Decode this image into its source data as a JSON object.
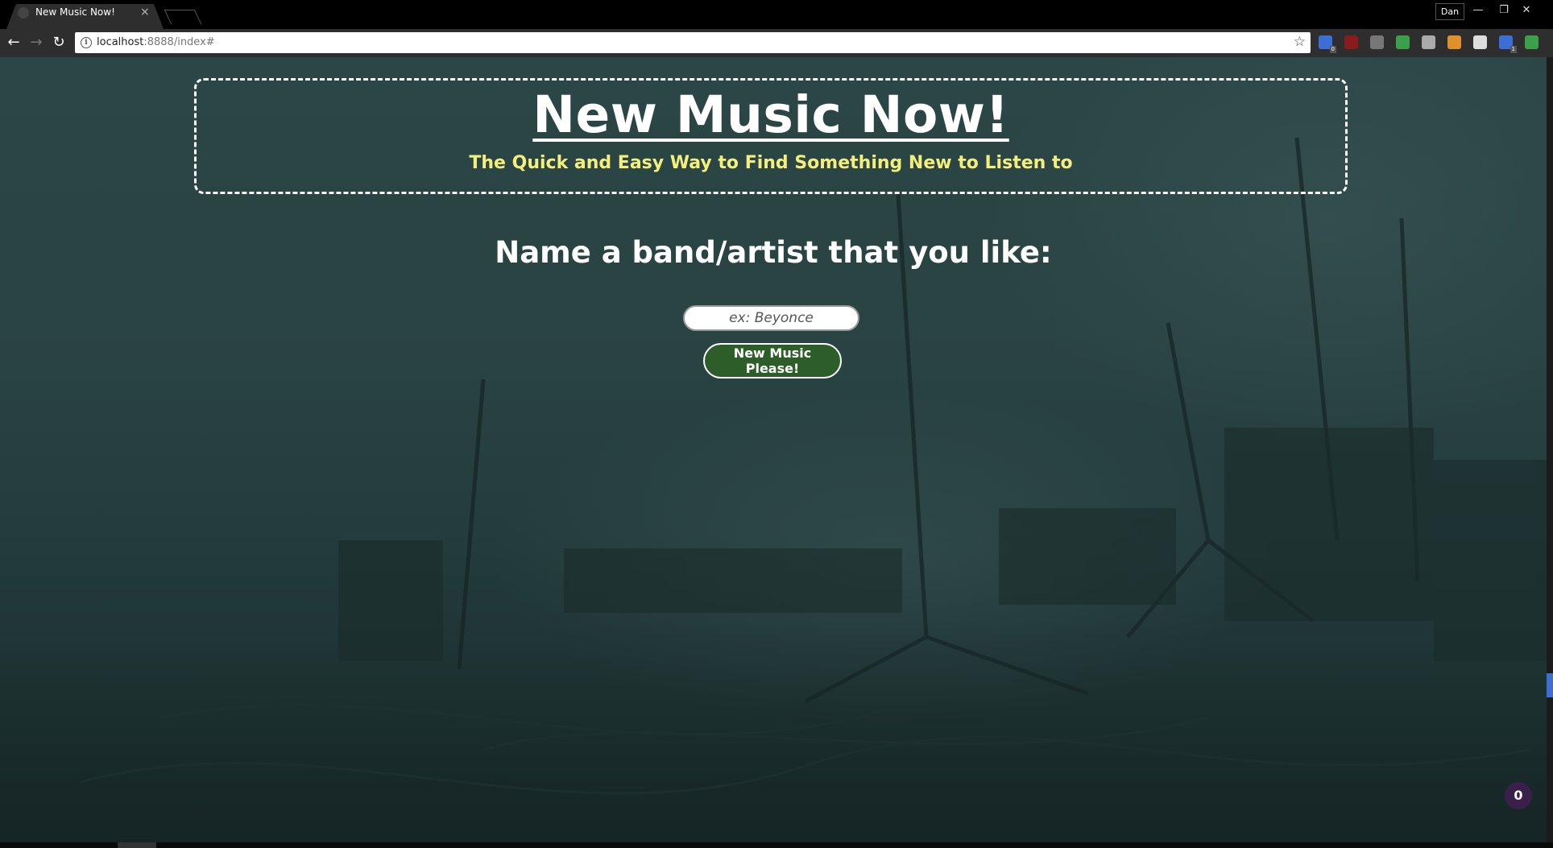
{
  "browser": {
    "tab_title": "New Music Now!",
    "tab_close": "×",
    "profile_name": "Dan",
    "url_host": "localhost",
    "url_rest": ":8888/index#",
    "controls": {
      "minimize": "—",
      "restore": "❐",
      "close": "✕"
    },
    "nav": {
      "back": "←",
      "forward": "→",
      "reload": "↻"
    },
    "extensions": [
      {
        "name": "extension-1-icon",
        "color": "#3b6fd6",
        "badge": "0"
      },
      {
        "name": "ublock-icon",
        "color": "#8b1a1a",
        "badge": ""
      },
      {
        "name": "extension-3-icon",
        "color": "#777777",
        "badge": ""
      },
      {
        "name": "checkmark-icon",
        "color": "#3aa14a",
        "badge": ""
      },
      {
        "name": "evernote-icon",
        "color": "#aaaaaa",
        "badge": ""
      },
      {
        "name": "extension-6-icon",
        "color": "#e0902a",
        "badge": ""
      },
      {
        "name": "extension-7-icon",
        "color": "#dddddd",
        "badge": ""
      },
      {
        "name": "extension-8-icon",
        "color": "#3b6fd6",
        "badge": "1"
      },
      {
        "name": "upload-icon",
        "color": "#3aa14a",
        "badge": ""
      }
    ]
  },
  "page": {
    "title": "New Music Now!",
    "subtitle": "The Quick and Easy Way to Find Something New to Listen to",
    "prompt": "Name a band/artist that you like:",
    "input_placeholder": "ex: Beyonce",
    "submit_label": "New Music Please!",
    "counter": "0",
    "colors": {
      "subtitle": "#f4ee7b",
      "button_bg": "#2d5e2a",
      "background": "#2a4343"
    }
  }
}
